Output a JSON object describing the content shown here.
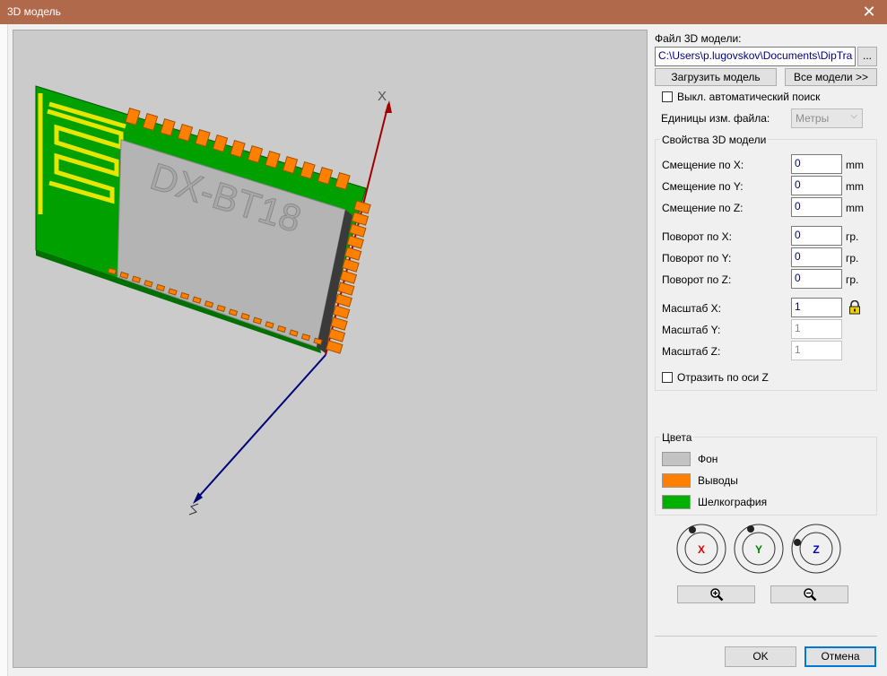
{
  "window": {
    "title": "3D модель",
    "close_glyph": "✕"
  },
  "viewport": {
    "component_text": "DX-BT18",
    "axis_x_label": "X",
    "axis_z_label": "Z"
  },
  "file": {
    "label": "Файл 3D модели:",
    "path": "C:\\Users\\p.lugovskov\\Documents\\DipTra",
    "browse_label": "...",
    "load_label": "Загрузить модель",
    "all_models_label": "Все модели >>"
  },
  "auto_search": {
    "label": "Выкл. автоматический поиск",
    "checked": false
  },
  "units": {
    "label": "Единицы изм. файла:",
    "value": "Метры"
  },
  "props": {
    "title": "Свойства 3D модели",
    "offset_x": {
      "label": "Смещение по X:",
      "value": "0",
      "unit": "mm"
    },
    "offset_y": {
      "label": "Смещение по Y:",
      "value": "0",
      "unit": "mm"
    },
    "offset_z": {
      "label": "Смещение по Z:",
      "value": "0",
      "unit": "mm"
    },
    "rot_x": {
      "label": "Поворот по X:",
      "value": "0",
      "unit": "гр."
    },
    "rot_y": {
      "label": "Поворот по Y:",
      "value": "0",
      "unit": "гр."
    },
    "rot_z": {
      "label": "Поворот по Z:",
      "value": "0",
      "unit": "гр."
    },
    "scale_x": {
      "label": "Масштаб X:",
      "value": "1"
    },
    "scale_y": {
      "label": "Масштаб Y:",
      "value": "1"
    },
    "scale_z": {
      "label": "Масштаб Z:",
      "value": "1"
    },
    "mirror": {
      "label": "Отразить по оси Z",
      "checked": false
    }
  },
  "colors": {
    "title": "Цвета",
    "items": [
      {
        "label": "Фон",
        "color": "#c3c3c3"
      },
      {
        "label": "Выводы",
        "color": "#ff8000"
      },
      {
        "label": "Шелкография",
        "color": "#00b000"
      }
    ]
  },
  "rotate_controls": {
    "x": {
      "label": "X",
      "color": "#e00000"
    },
    "y": {
      "label": "Y",
      "color": "#008000"
    },
    "z": {
      "label": "Z",
      "color": "#0000c0"
    }
  },
  "zoom": {
    "in_icon": "zoom-in",
    "out_icon": "zoom-out"
  },
  "footer": {
    "ok_label": "OK",
    "cancel_label": "Отмена"
  }
}
